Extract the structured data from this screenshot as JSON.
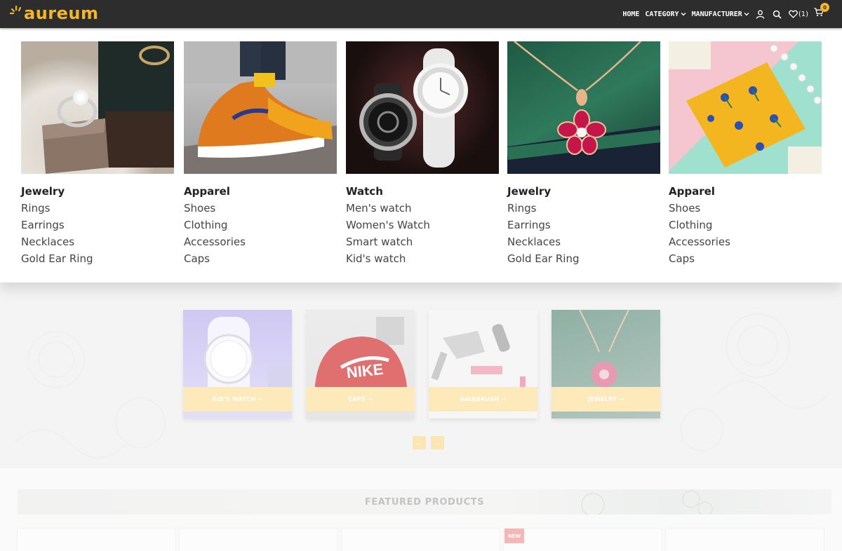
{
  "header": {
    "logo_text": "aureum",
    "nav": {
      "home": "HOME",
      "category": "CATEGORY",
      "manufacturer": "MANUFACTURER",
      "wishlist_count": "(1)",
      "cart_count": "0"
    },
    "icons": [
      "account-icon",
      "search-icon",
      "heart-icon",
      "cart-icon",
      "chevron-down-icon"
    ]
  },
  "mega_menu": {
    "columns": [
      {
        "title": "Jewelry",
        "links": [
          "Rings",
          "Earrings",
          "Necklaces",
          "Gold Ear Ring"
        ]
      },
      {
        "title": "Apparel",
        "links": [
          "Shoes",
          "Clothing",
          "Accessories",
          "Caps"
        ]
      },
      {
        "title": "Watch",
        "links": [
          "Men's watch",
          "Women's Watch",
          "Smart watch",
          "Kid's watch"
        ]
      },
      {
        "title": "Jewelry",
        "links": [
          "Rings",
          "Earrings",
          "Necklaces",
          "Gold Ear Ring"
        ]
      },
      {
        "title": "Apparel",
        "links": [
          "Shoes",
          "Clothing",
          "Accessories",
          "Caps"
        ]
      }
    ]
  },
  "category_carousel": {
    "items": [
      {
        "label": "KID'S WATCH →"
      },
      {
        "label": "CAPS →"
      },
      {
        "label": "HAIRBRUSH →"
      },
      {
        "label": "JEWELRY →"
      }
    ],
    "prev": "←",
    "next": "→"
  },
  "featured": {
    "title": "FEATURED PRODUCTS",
    "badge": "NEW"
  },
  "colors": {
    "header_bg": "#2d2d2d",
    "brand_accent": "#f3b52c",
    "label_bg": "#fde9b9"
  }
}
